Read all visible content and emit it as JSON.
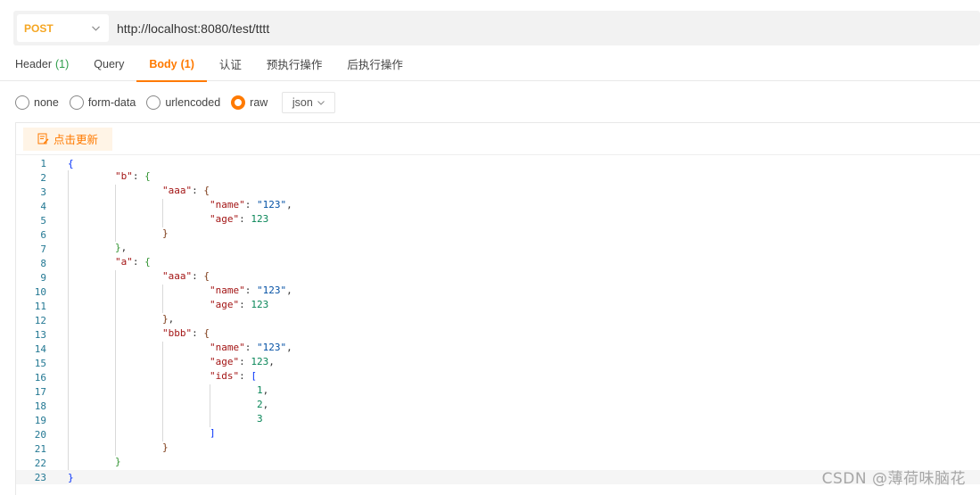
{
  "request": {
    "method": "POST",
    "method_icon": "chevron-down-icon",
    "url": "http://localhost:8080/test/tttt"
  },
  "tabs": [
    {
      "label": "Header",
      "count": "(1)",
      "active": false
    },
    {
      "label": "Query",
      "count": "",
      "active": false
    },
    {
      "label": "Body",
      "count": "(1)",
      "active": true
    },
    {
      "label": "认证",
      "count": "",
      "active": false
    },
    {
      "label": "预执行操作",
      "count": "",
      "active": false
    },
    {
      "label": "后执行操作",
      "count": "",
      "active": false
    }
  ],
  "body_types": [
    {
      "label": "none",
      "checked": false
    },
    {
      "label": "form-data",
      "checked": false
    },
    {
      "label": "urlencoded",
      "checked": false
    },
    {
      "label": "raw",
      "checked": true
    }
  ],
  "format_select": {
    "value": "json"
  },
  "editor": {
    "refresh_label": "点击更新",
    "refresh_icon": "edit-document-icon",
    "current_line": 23,
    "lines": [
      {
        "n": "1",
        "depth": 0,
        "tokens": [
          [
            "b1",
            "{"
          ]
        ]
      },
      {
        "n": "2",
        "depth": 1,
        "tokens": [
          [
            "key",
            "\"b\""
          ],
          [
            "punc",
            ": "
          ],
          [
            "b2",
            "{"
          ]
        ]
      },
      {
        "n": "3",
        "depth": 2,
        "tokens": [
          [
            "key",
            "\"aaa\""
          ],
          [
            "punc",
            ": "
          ],
          [
            "b3",
            "{"
          ]
        ]
      },
      {
        "n": "4",
        "depth": 3,
        "tokens": [
          [
            "key",
            "\"name\""
          ],
          [
            "punc",
            ": "
          ],
          [
            "str",
            "\"123\""
          ],
          [
            "punc",
            ","
          ]
        ]
      },
      {
        "n": "5",
        "depth": 3,
        "tokens": [
          [
            "key",
            "\"age\""
          ],
          [
            "punc",
            ": "
          ],
          [
            "num",
            "123"
          ]
        ]
      },
      {
        "n": "6",
        "depth": 2,
        "tokens": [
          [
            "b3",
            "}"
          ]
        ]
      },
      {
        "n": "7",
        "depth": 1,
        "tokens": [
          [
            "b2",
            "}"
          ],
          [
            "punc",
            ","
          ]
        ]
      },
      {
        "n": "8",
        "depth": 1,
        "tokens": [
          [
            "key",
            "\"a\""
          ],
          [
            "punc",
            ": "
          ],
          [
            "b2",
            "{"
          ]
        ]
      },
      {
        "n": "9",
        "depth": 2,
        "tokens": [
          [
            "key",
            "\"aaa\""
          ],
          [
            "punc",
            ": "
          ],
          [
            "b3",
            "{"
          ]
        ]
      },
      {
        "n": "10",
        "depth": 3,
        "tokens": [
          [
            "key",
            "\"name\""
          ],
          [
            "punc",
            ": "
          ],
          [
            "str",
            "\"123\""
          ],
          [
            "punc",
            ","
          ]
        ]
      },
      {
        "n": "11",
        "depth": 3,
        "tokens": [
          [
            "key",
            "\"age\""
          ],
          [
            "punc",
            ": "
          ],
          [
            "num",
            "123"
          ]
        ]
      },
      {
        "n": "12",
        "depth": 2,
        "tokens": [
          [
            "b3",
            "}"
          ],
          [
            "punc",
            ","
          ]
        ]
      },
      {
        "n": "13",
        "depth": 2,
        "tokens": [
          [
            "key",
            "\"bbb\""
          ],
          [
            "punc",
            ": "
          ],
          [
            "b3",
            "{"
          ]
        ]
      },
      {
        "n": "14",
        "depth": 3,
        "tokens": [
          [
            "key",
            "\"name\""
          ],
          [
            "punc",
            ": "
          ],
          [
            "str",
            "\"123\""
          ],
          [
            "punc",
            ","
          ]
        ]
      },
      {
        "n": "15",
        "depth": 3,
        "tokens": [
          [
            "key",
            "\"age\""
          ],
          [
            "punc",
            ": "
          ],
          [
            "num",
            "123"
          ],
          [
            "punc",
            ","
          ]
        ]
      },
      {
        "n": "16",
        "depth": 3,
        "tokens": [
          [
            "key",
            "\"ids\""
          ],
          [
            "punc",
            ": "
          ],
          [
            "b1",
            "["
          ]
        ]
      },
      {
        "n": "17",
        "depth": 4,
        "tokens": [
          [
            "num",
            "1"
          ],
          [
            "punc",
            ","
          ]
        ]
      },
      {
        "n": "18",
        "depth": 4,
        "tokens": [
          [
            "num",
            "2"
          ],
          [
            "punc",
            ","
          ]
        ]
      },
      {
        "n": "19",
        "depth": 4,
        "tokens": [
          [
            "num",
            "3"
          ]
        ]
      },
      {
        "n": "20",
        "depth": 3,
        "tokens": [
          [
            "b1",
            "]"
          ]
        ]
      },
      {
        "n": "21",
        "depth": 2,
        "tokens": [
          [
            "b3",
            "}"
          ]
        ]
      },
      {
        "n": "22",
        "depth": 1,
        "tokens": [
          [
            "b2",
            "}"
          ]
        ]
      },
      {
        "n": "23",
        "depth": 0,
        "tokens": [
          [
            "b1",
            "}"
          ]
        ]
      }
    ]
  },
  "watermark": "CSDN @薄荷味脑花",
  "colors": {
    "accent": "#ff7a00",
    "method": "#f5a623",
    "count": "#2e9d4a",
    "line_number": "#237893"
  }
}
